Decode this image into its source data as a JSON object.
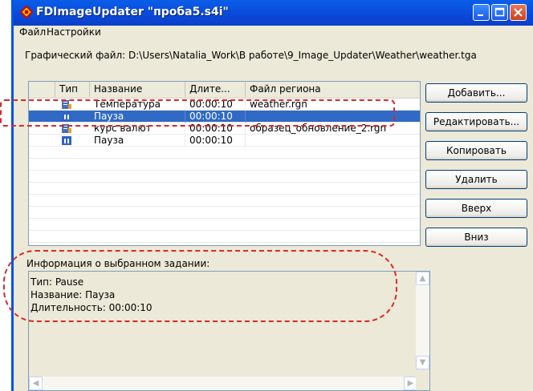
{
  "window": {
    "title": "FDImageUpdater \"проба5.s4i\""
  },
  "menu": [
    "Файл",
    "Настройки"
  ],
  "graphic_file": "Графический файл: D:\\Users\\Natalia_Work\\В работе\\9_Image_Updater\\Weather\\weather.tga",
  "table": {
    "columns": [
      "Тип",
      "Название",
      "Длите...",
      "Файл региона"
    ],
    "rows": [
      {
        "name": "Температура",
        "duration": "00:00:10",
        "region": "weather.rgn",
        "icon": "weather-task-icon"
      },
      {
        "name": "Пауза",
        "duration": "00:00:10",
        "region": "",
        "icon": "pause-task-icon"
      },
      {
        "name": "курс валют",
        "duration": "00:00:10",
        "region": "образец_обновление_2.rgn",
        "icon": "weather-task-icon"
      },
      {
        "name": "Пауза",
        "duration": "00:00:10",
        "region": "",
        "icon": "pause-task-icon"
      }
    ],
    "selected_index": 1
  },
  "buttons": {
    "add": "Добавить...",
    "edit": "Редактировать...",
    "copy": "Копировать",
    "delete": "Удалить",
    "up": "Вверх",
    "down": "Вниз"
  },
  "info": {
    "label": "Информация о выбранном задании:",
    "type_line": "Тип: Pause",
    "name_line": "Название: Пауза",
    "duration_line": "Длительность: 00:00:10"
  },
  "colors": {
    "title_bar": "#0a48d8",
    "selection": "#316ac5",
    "annotation": "#d62a2a"
  }
}
